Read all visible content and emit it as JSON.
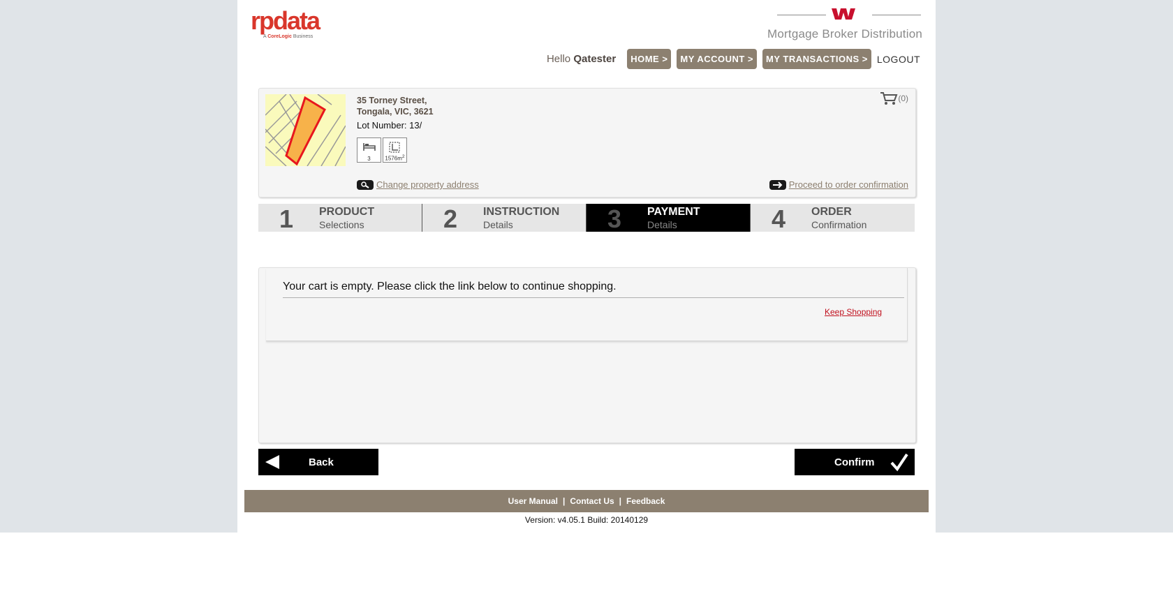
{
  "header": {
    "logo_text": "rpdata",
    "logo_sub_prefix": "A",
    "logo_sub_brand": "CoreLogic",
    "logo_sub_suffix": "Business",
    "brand_text": "Mortgage Broker Distribution",
    "brand_color": "#c8102e"
  },
  "nav": {
    "hello": "Hello",
    "username": "Qatester",
    "home": "HOME >",
    "my_account": "MY ACCOUNT >",
    "my_transactions": "MY TRANSACTIONS >",
    "logout": "LOGOUT"
  },
  "property": {
    "address_line1": "35 Torney Street,",
    "address_line2": "Tongala, VIC, 3621",
    "lot": "Lot Number: 13/",
    "bedrooms": "3",
    "land_area": "1576m",
    "land_area_unit_sup": "2",
    "change_address": "Change property address",
    "proceed": "Proceed to order confirmation",
    "cart_count": "(0)"
  },
  "steps": [
    {
      "num": "1",
      "title": "PRODUCT",
      "subtitle": "Selections",
      "active": false
    },
    {
      "num": "2",
      "title": "INSTRUCTION",
      "subtitle": "Details",
      "active": false
    },
    {
      "num": "3",
      "title": "PAYMENT",
      "subtitle": "Details",
      "active": true
    },
    {
      "num": "4",
      "title": "ORDER",
      "subtitle": "Confirmation",
      "active": false
    }
  ],
  "cart": {
    "message": "Your cart is empty. Please click the link below to continue shopping.",
    "keep_shopping": "Keep Shopping"
  },
  "buttons": {
    "back": "Back",
    "confirm": "Confirm"
  },
  "footer": {
    "user_manual": "User Manual",
    "contact_us": "Contact Us",
    "feedback": "Feedback",
    "separator": "|",
    "version": "Version: v4.05.1 Build: 20140129"
  },
  "colors": {
    "nav_button": "#8c8070",
    "logo_red": "#d9362b",
    "link_red": "#c0111e",
    "step_active": "#000000"
  }
}
